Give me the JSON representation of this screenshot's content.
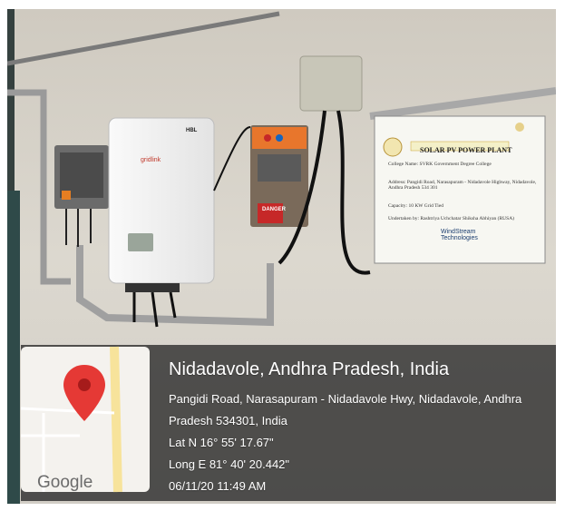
{
  "location": {
    "city_line": "Nidadavole, Andhra Pradesh, India",
    "address_line1": "Pangidi Road, Narasapuram - Nidadavole Hwy, Nidadavole, Andhra",
    "address_line2": "Pradesh 534301, India",
    "latitude": "Lat N 16° 55' 17.67\"",
    "longitude": "Long E 81° 40' 20.442\"",
    "timestamp": "06/11/20 11:49 AM"
  },
  "map": {
    "brand": "Google",
    "pin_icon": "map-pin-icon",
    "pin_color": "#e53935"
  },
  "board": {
    "title": "SOLAR PV POWER PLANT",
    "college": "College Name: SVRK Government Degree College",
    "address": "Address: Pangidi Road, Narasapuram - Nidadavole Highway, Nidadavole, Andhra Pradesh 534 301",
    "capacity": "Capacity: 10 KW Grid Tied",
    "undertaken": "Undertaken by: Rashtriya Uchchatar Shiksha Abhiyan (RUSA)",
    "installer": "WindStream Technologies"
  },
  "inverter": {
    "brand": "gridlink",
    "logo": "HBL"
  },
  "panel": {
    "warning": "DANGER"
  }
}
